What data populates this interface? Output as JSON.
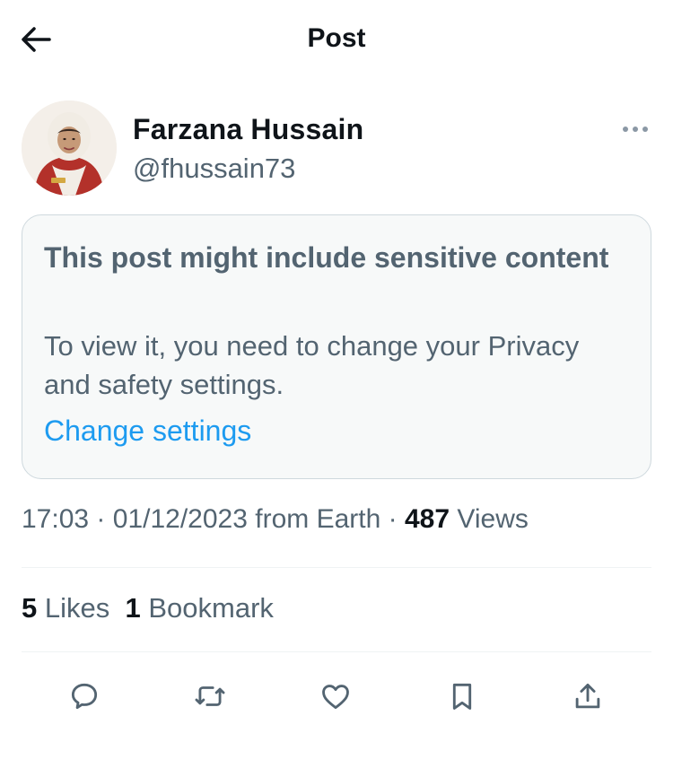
{
  "header": {
    "back_icon": "arrow-left-icon",
    "title": "Post"
  },
  "author": {
    "name": "Farzana Hussain",
    "handle": "@fhussain73",
    "more_icon": "more-horizontal-icon"
  },
  "sensitive_notice": {
    "title": "This post might include sensitive content",
    "body": "To view it, you need to change your Privacy and safety settings.",
    "link": "Change settings"
  },
  "meta": {
    "time": "17:03",
    "separator": "·",
    "date": "01/12/2023",
    "source": "from Earth",
    "views_count": "487",
    "views_label": "Views"
  },
  "stats": {
    "likes_count": "5",
    "likes_label": "Likes",
    "bookmarks_count": "1",
    "bookmarks_label": "Bookmark"
  },
  "actions": [
    {
      "name": "reply",
      "icon": "comment-icon"
    },
    {
      "name": "repost",
      "icon": "repost-icon"
    },
    {
      "name": "like",
      "icon": "heart-icon"
    },
    {
      "name": "bookmark",
      "icon": "bookmark-icon"
    },
    {
      "name": "share",
      "icon": "share-icon"
    }
  ],
  "colors": {
    "text_primary": "#0f1419",
    "text_secondary": "#536471",
    "link": "#1d9bf0",
    "card_background": "#f7f9f9",
    "border": "#cfd9de",
    "divider": "#eff3f4"
  }
}
